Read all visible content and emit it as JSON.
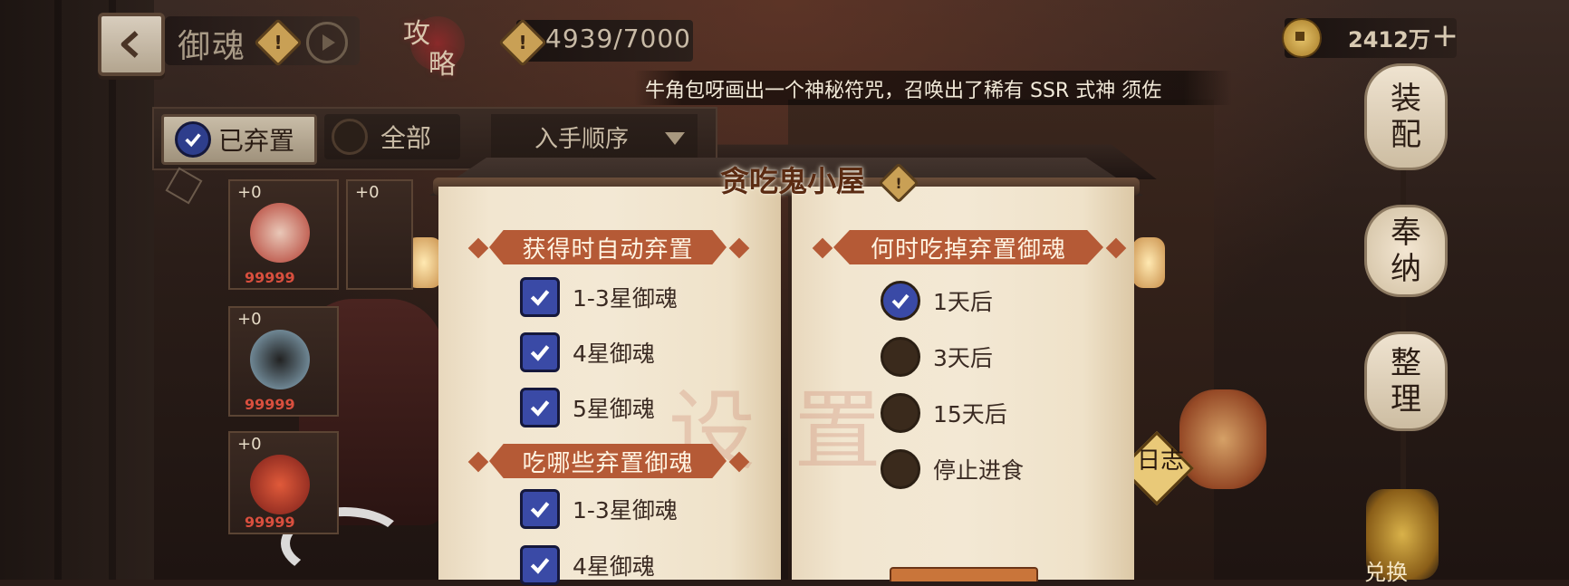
{
  "header": {
    "back_icon": "back-arrow-icon",
    "title": "御魂",
    "info_icon": "exclamation-diamond-icon",
    "play_icon": "play-icon",
    "guide_chars": [
      "攻",
      "略"
    ],
    "capacity_icon": "exclamation-diamond-icon",
    "capacity": "4939/7000",
    "coins": "2412万",
    "coin_icon": "coin-icon",
    "add_icon": "plus-icon"
  },
  "broadcast": "牛角包呀画出一个神秘符咒，召唤出了稀有 SSR 式神 须佐",
  "filters": {
    "abandoned_label": "已弃置",
    "all_label": "全部",
    "sort_label": "入手顺序"
  },
  "cards": [
    {
      "level": "+0",
      "count": "99999"
    },
    {
      "level": "+0",
      "count": ""
    },
    {
      "level": "+0",
      "count": "99999"
    },
    {
      "level": "+0",
      "count": "99999"
    }
  ],
  "side_menu": {
    "equip": [
      "装",
      "配"
    ],
    "offer": [
      "奉",
      "纳"
    ],
    "organize": [
      "整",
      "理"
    ],
    "exchange_label": "兑换"
  },
  "log_label": "日志",
  "modal": {
    "title": "贪吃鬼小屋",
    "watermark": "设 置",
    "left": {
      "section1": "获得时自动弃置",
      "section1_options": [
        {
          "label": "1-3星御魂",
          "checked": true
        },
        {
          "label": "4星御魂",
          "checked": true
        },
        {
          "label": "5星御魂",
          "checked": true
        }
      ],
      "section2": "吃哪些弃置御魂",
      "section2_options": [
        {
          "label": "1-3星御魂",
          "checked": true
        },
        {
          "label": "4星御魂",
          "checked": true
        }
      ]
    },
    "right": {
      "section": "何时吃掉弃置御魂",
      "options": [
        {
          "label": "1天后",
          "selected": true
        },
        {
          "label": "3天后",
          "selected": false
        },
        {
          "label": "15天后",
          "selected": false
        },
        {
          "label": "停止进食",
          "selected": false
        }
      ]
    }
  },
  "colors": {
    "check_blue": "#3a4aa6",
    "section_banner": "#b55a36",
    "scroll_paper": "#f3e8d4"
  }
}
